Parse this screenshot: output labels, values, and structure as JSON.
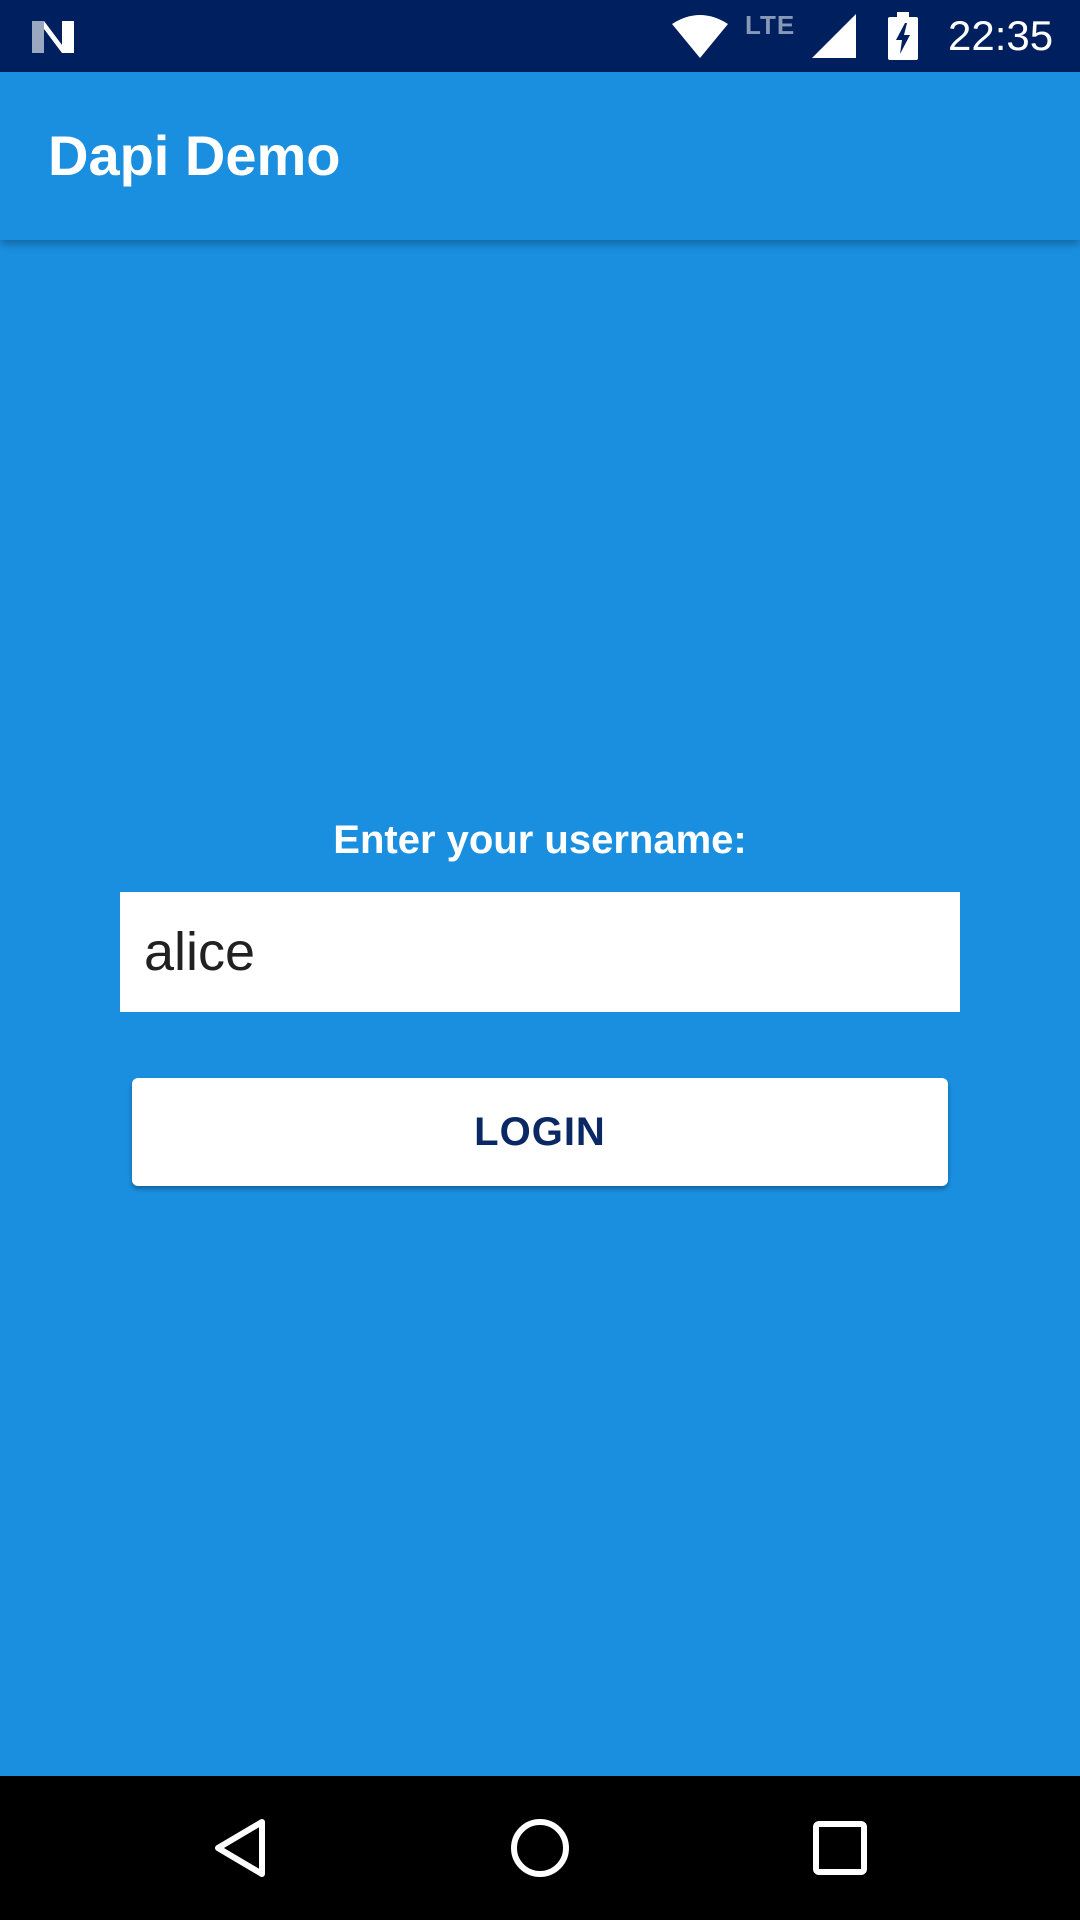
{
  "status_bar": {
    "time": "22:35",
    "network_type": "LTE",
    "icons": [
      "n-logo-icon",
      "wifi-icon",
      "cell-signal-icon",
      "battery-charging-icon"
    ]
  },
  "app_bar": {
    "title": "Dapi Demo"
  },
  "login_form": {
    "prompt": "Enter your username:",
    "username_value": "alice",
    "login_button_label": "LOGIN"
  },
  "nav_bar": {
    "icons": [
      "back-icon",
      "home-icon",
      "recents-icon"
    ]
  },
  "colors": {
    "status_bar_bg": "#001F5E",
    "primary": "#1A8FE0",
    "button_text": "#0A2863",
    "nav_bar_bg": "#000000"
  }
}
